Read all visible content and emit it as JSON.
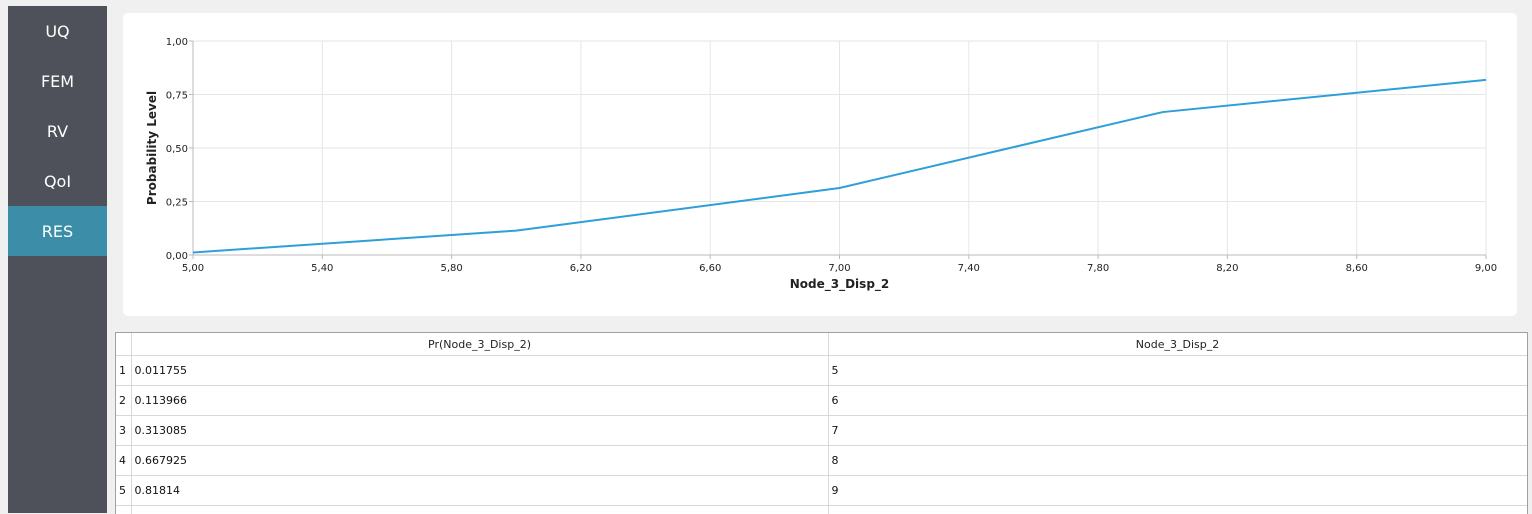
{
  "sidebar": {
    "items": [
      {
        "label": "UQ",
        "active": false
      },
      {
        "label": "FEM",
        "active": false
      },
      {
        "label": "RV",
        "active": false
      },
      {
        "label": "QoI",
        "active": false
      },
      {
        "label": "RES",
        "active": true
      }
    ]
  },
  "chart_data": {
    "type": "line",
    "xlabel": "Node_3_Disp_2",
    "ylabel": "Probability Level",
    "xlim": [
      5.0,
      9.0
    ],
    "ylim": [
      0.0,
      1.0
    ],
    "x_ticks": [
      "5,00",
      "5,40",
      "5,80",
      "6,20",
      "6,60",
      "7,00",
      "7,40",
      "7,80",
      "8,20",
      "8,60",
      "9,00"
    ],
    "y_ticks": [
      "0,00",
      "0,25",
      "0,50",
      "0,75",
      "1,00"
    ],
    "grid": true,
    "color": "#2e9fd8",
    "series": [
      {
        "x": [
          5,
          6,
          7,
          8,
          9
        ],
        "y": [
          0.011755,
          0.113966,
          0.313085,
          0.667925,
          0.81814
        ]
      }
    ]
  },
  "table": {
    "headers": [
      "Pr(Node_3_Disp_2)",
      "Node_3_Disp_2"
    ],
    "rows": [
      {
        "n": "1",
        "pr": "0.011755",
        "val": "5"
      },
      {
        "n": "2",
        "pr": "0.113966",
        "val": "6"
      },
      {
        "n": "3",
        "pr": "0.313085",
        "val": "7"
      },
      {
        "n": "4",
        "pr": "0.667925",
        "val": "8"
      },
      {
        "n": "5",
        "pr": "0.81814",
        "val": "9"
      }
    ]
  }
}
